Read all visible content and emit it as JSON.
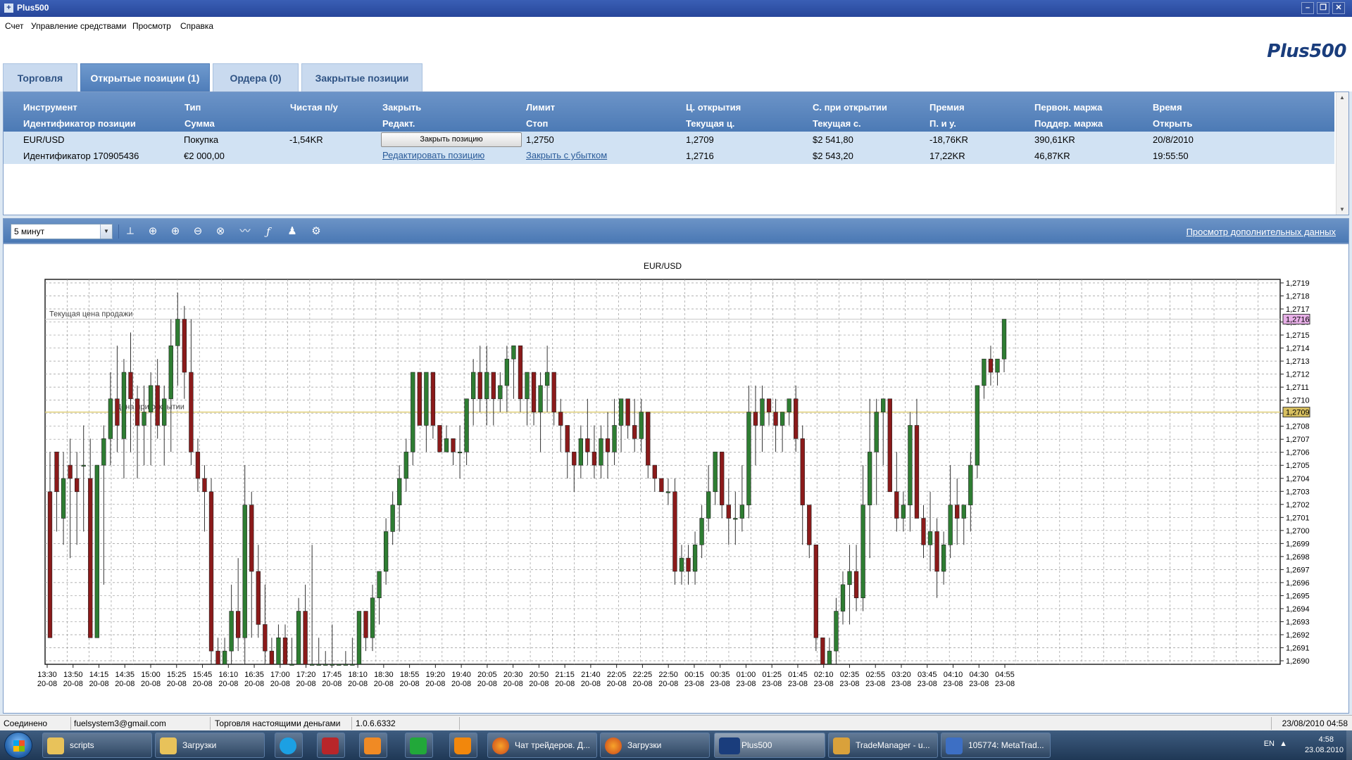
{
  "window": {
    "title": "Plus500",
    "minimize": "–",
    "restore": "❐",
    "close": "✕"
  },
  "menu": [
    "Счет",
    "Управление средствами",
    "Просмотр",
    "Справка"
  ],
  "logo": "Plus500",
  "tabs": [
    "Торговля",
    "Открытые позиции (1)",
    "Ордера (0)",
    "Закрытые позиции"
  ],
  "grid": {
    "header1": [
      "Инструмент",
      "Тип",
      "Чистая п/у",
      "Закрыть",
      "Лимит",
      "Ц. открытия",
      "С. при открытии",
      "Премия",
      "Первон. маржа",
      "Время"
    ],
    "header2": [
      "Идентификатор позиции",
      "Сумма",
      "",
      "Редакт.",
      "Стоп",
      "Текущая ц.",
      "Текущая с.",
      "П. и у.",
      "Поддер. маржа",
      "Открыть"
    ],
    "row1": [
      "EUR/USD",
      "Покупка",
      "-1,54KR",
      "Закрыть позицию",
      "1,2750",
      "1,2709",
      "$2 541,80",
      "-18,76KR",
      "390,61KR",
      "20/8/2010"
    ],
    "row2": [
      "Идентификатор 170905436",
      "€2 000,00",
      "",
      "Редактировать позицию",
      "Закрыть с убытком",
      "1,2716",
      "$2 543,20",
      "17,22KR",
      "46,87KR",
      "19:55:50"
    ]
  },
  "toolbar": {
    "timeframe": "5 минут",
    "more_link": "Просмотр дополнительных данных"
  },
  "chart_data": {
    "type": "candlestick",
    "title": "EUR/USD",
    "ylim": [
      1.269,
      1.2719
    ],
    "y_ticks": [
      "1,2719",
      "1,2718",
      "1,2717",
      "1,2716",
      "1,2715",
      "1,2714",
      "1,2713",
      "1,2712",
      "1,2711",
      "1,2710",
      "1,2709",
      "1,2708",
      "1,2707",
      "1,2706",
      "1,2705",
      "1,2704",
      "1,2703",
      "1,2702",
      "1,2701",
      "1,2700",
      "1,2699",
      "1,2698",
      "1,2697",
      "1,2696",
      "1,2695",
      "1,2694",
      "1,2693",
      "1,2692",
      "1,2691",
      "1,2690"
    ],
    "x_ticks": [
      [
        "13:30",
        "20-08"
      ],
      [
        "13:50",
        "20-08"
      ],
      [
        "14:15",
        "20-08"
      ],
      [
        "14:35",
        "20-08"
      ],
      [
        "15:00",
        "20-08"
      ],
      [
        "15:25",
        "20-08"
      ],
      [
        "15:45",
        "20-08"
      ],
      [
        "16:10",
        "20-08"
      ],
      [
        "16:35",
        "20-08"
      ],
      [
        "17:00",
        "20-08"
      ],
      [
        "17:20",
        "20-08"
      ],
      [
        "17:45",
        "20-08"
      ],
      [
        "18:10",
        "20-08"
      ],
      [
        "18:30",
        "20-08"
      ],
      [
        "18:55",
        "20-08"
      ],
      [
        "19:20",
        "20-08"
      ],
      [
        "19:40",
        "20-08"
      ],
      [
        "20:05",
        "20-08"
      ],
      [
        "20:30",
        "20-08"
      ],
      [
        "20:50",
        "20-08"
      ],
      [
        "21:15",
        "20-08"
      ],
      [
        "21:40",
        "20-08"
      ],
      [
        "22:05",
        "20-08"
      ],
      [
        "22:25",
        "20-08"
      ],
      [
        "22:50",
        "20-08"
      ],
      [
        "00:15",
        "23-08"
      ],
      [
        "00:35",
        "23-08"
      ],
      [
        "01:00",
        "23-08"
      ],
      [
        "01:25",
        "23-08"
      ],
      [
        "01:45",
        "23-08"
      ],
      [
        "02:10",
        "23-08"
      ],
      [
        "02:35",
        "23-08"
      ],
      [
        "02:55",
        "23-08"
      ],
      [
        "03:20",
        "23-08"
      ],
      [
        "03:45",
        "23-08"
      ],
      [
        "04:10",
        "23-08"
      ],
      [
        "04:30",
        "23-08"
      ],
      [
        "04:55",
        "23-08"
      ]
    ],
    "grid": true,
    "sell_price_line": {
      "label": "Текущая цена продажи",
      "value": 1.2716,
      "tag": "1,2716",
      "color": "#e8b0e8"
    },
    "open_price_line": {
      "label": "Цена при открытии",
      "value": 1.2709,
      "tag": "1,2709",
      "color": "#d8c060"
    },
    "candles": [
      [
        1.2703,
        1.2706,
        1.2692,
        1.2692
      ],
      [
        1.2706,
        1.2706,
        1.27,
        1.2703
      ],
      [
        1.2701,
        1.2706,
        1.2699,
        1.2704
      ],
      [
        1.2705,
        1.2707,
        1.2698,
        1.2704
      ],
      [
        1.2704,
        1.2706,
        1.2699,
        1.2703
      ],
      [
        1.2705,
        1.2708,
        1.27,
        1.2705
      ],
      [
        1.2704,
        1.2707,
        1.2692,
        1.2692
      ],
      [
        1.2692,
        1.2705,
        1.2692,
        1.2705
      ],
      [
        1.2705,
        1.2708,
        1.2696,
        1.2707
      ],
      [
        1.2707,
        1.2712,
        1.2705,
        1.271
      ],
      [
        1.271,
        1.2714,
        1.2706,
        1.2708
      ],
      [
        1.2707,
        1.2713,
        1.2704,
        1.2712
      ],
      [
        1.2712,
        1.2715,
        1.2706,
        1.271
      ],
      [
        1.271,
        1.2711,
        1.2704,
        1.2708
      ],
      [
        1.2708,
        1.2711,
        1.2705,
        1.2709
      ],
      [
        1.2709,
        1.2712,
        1.2705,
        1.2711
      ],
      [
        1.2711,
        1.2713,
        1.2707,
        1.2708
      ],
      [
        1.2708,
        1.2711,
        1.2705,
        1.271
      ],
      [
        1.271,
        1.2716,
        1.2706,
        1.2714
      ],
      [
        1.2714,
        1.2718,
        1.2711,
        1.2716
      ],
      [
        1.2716,
        1.2717,
        1.271,
        1.2712
      ],
      [
        1.2712,
        1.2716,
        1.2705,
        1.2706
      ],
      [
        1.2706,
        1.2707,
        1.2703,
        1.2704
      ],
      [
        1.2704,
        1.2705,
        1.27,
        1.2703
      ],
      [
        1.2703,
        1.2704,
        1.269,
        1.2691
      ],
      [
        1.2691,
        1.2692,
        1.269,
        1.269
      ],
      [
        1.269,
        1.2692,
        1.269,
        1.2691
      ],
      [
        1.2691,
        1.2696,
        1.269,
        1.2694
      ],
      [
        1.2694,
        1.2698,
        1.2691,
        1.2692
      ],
      [
        1.2692,
        1.2705,
        1.269,
        1.2702
      ],
      [
        1.2702,
        1.2703,
        1.2692,
        1.2697
      ],
      [
        1.2697,
        1.2699,
        1.2692,
        1.2693
      ],
      [
        1.2693,
        1.2696,
        1.269,
        1.2691
      ],
      [
        1.2691,
        1.2692,
        1.269,
        1.269
      ],
      [
        1.269,
        1.2693,
        1.269,
        1.2692
      ],
      [
        1.2692,
        1.2693,
        1.269,
        1.269
      ],
      [
        1.269,
        1.2692,
        1.269,
        1.269
      ],
      [
        1.269,
        1.2695,
        1.269,
        1.2694
      ],
      [
        1.2694,
        1.2696,
        1.269,
        1.269
      ],
      [
        1.269,
        1.2699,
        1.269,
        1.269
      ],
      [
        1.269,
        1.2692,
        1.269,
        1.269
      ],
      [
        1.269,
        1.2691,
        1.269,
        1.269
      ],
      [
        1.269,
        1.2693,
        1.269,
        1.269
      ],
      [
        1.269,
        1.269,
        1.269,
        1.269
      ],
      [
        1.269,
        1.2691,
        1.269,
        1.269
      ],
      [
        1.269,
        1.2692,
        1.269,
        1.269
      ],
      [
        1.269,
        1.2694,
        1.269,
        1.2694
      ],
      [
        1.2694,
        1.2694,
        1.2691,
        1.2692
      ],
      [
        1.2692,
        1.2696,
        1.2691,
        1.2695
      ],
      [
        1.2695,
        1.2697,
        1.2693,
        1.2697
      ],
      [
        1.2697,
        1.2701,
        1.2696,
        1.27
      ],
      [
        1.27,
        1.2703,
        1.2699,
        1.2702
      ],
      [
        1.2702,
        1.2705,
        1.27,
        1.2704
      ],
      [
        1.2704,
        1.2707,
        1.2703,
        1.2706
      ],
      [
        1.2706,
        1.2712,
        1.2705,
        1.2712
      ],
      [
        1.2712,
        1.2712,
        1.2708,
        1.2708
      ],
      [
        1.2708,
        1.2712,
        1.2706,
        1.2712
      ],
      [
        1.2712,
        1.2712,
        1.2707,
        1.2708
      ],
      [
        1.2708,
        1.2708,
        1.2706,
        1.2706
      ],
      [
        1.2706,
        1.2708,
        1.2706,
        1.2707
      ],
      [
        1.2707,
        1.2707,
        1.2705,
        1.2706
      ],
      [
        1.2706,
        1.2708,
        1.2704,
        1.2706
      ],
      [
        1.2706,
        1.271,
        1.2705,
        1.271
      ],
      [
        1.271,
        1.2713,
        1.2708,
        1.2712
      ],
      [
        1.2712,
        1.2714,
        1.2709,
        1.271
      ],
      [
        1.271,
        1.2714,
        1.2708,
        1.2712
      ],
      [
        1.2712,
        1.2712,
        1.2708,
        1.271
      ],
      [
        1.271,
        1.2712,
        1.2709,
        1.2711
      ],
      [
        1.2711,
        1.2714,
        1.2709,
        1.2713
      ],
      [
        1.2713,
        1.2714,
        1.271,
        1.2714
      ],
      [
        1.2714,
        1.2714,
        1.2709,
        1.271
      ],
      [
        1.271,
        1.2712,
        1.2708,
        1.2712
      ],
      [
        1.2712,
        1.2712,
        1.2708,
        1.2709
      ],
      [
        1.2709,
        1.2712,
        1.2706,
        1.2711
      ],
      [
        1.2711,
        1.2714,
        1.2709,
        1.2712
      ],
      [
        1.2712,
        1.2712,
        1.2708,
        1.2709
      ],
      [
        1.2709,
        1.271,
        1.2706,
        1.2708
      ],
      [
        1.2708,
        1.2708,
        1.2704,
        1.2706
      ],
      [
        1.2706,
        1.2706,
        1.2703,
        1.2705
      ],
      [
        1.2705,
        1.2708,
        1.2704,
        1.2707
      ],
      [
        1.2707,
        1.271,
        1.2705,
        1.2706
      ],
      [
        1.2706,
        1.2708,
        1.2704,
        1.2705
      ],
      [
        1.2705,
        1.2708,
        1.2704,
        1.2707
      ],
      [
        1.2707,
        1.2709,
        1.2704,
        1.2706
      ],
      [
        1.2706,
        1.271,
        1.2705,
        1.2708
      ],
      [
        1.2708,
        1.271,
        1.2706,
        1.271
      ],
      [
        1.271,
        1.271,
        1.2707,
        1.2708
      ],
      [
        1.2708,
        1.271,
        1.2706,
        1.2707
      ],
      [
        1.2707,
        1.271,
        1.2706,
        1.2709
      ],
      [
        1.2709,
        1.2709,
        1.2704,
        1.2705
      ],
      [
        1.2705,
        1.2705,
        1.2703,
        1.2704
      ],
      [
        1.2704,
        1.2704,
        1.2703,
        1.2703
      ],
      [
        1.2703,
        1.2704,
        1.2702,
        1.2703
      ],
      [
        1.2703,
        1.2704,
        1.2696,
        1.2697
      ],
      [
        1.2697,
        1.2699,
        1.2696,
        1.2698
      ],
      [
        1.2698,
        1.2699,
        1.2696,
        1.2697
      ],
      [
        1.2697,
        1.27,
        1.2696,
        1.2699
      ],
      [
        1.2699,
        1.2702,
        1.2698,
        1.2701
      ],
      [
        1.2701,
        1.2705,
        1.27,
        1.2703
      ],
      [
        1.2703,
        1.2706,
        1.2702,
        1.2706
      ],
      [
        1.2706,
        1.2706,
        1.2701,
        1.2702
      ],
      [
        1.2702,
        1.2704,
        1.2699,
        1.2701
      ],
      [
        1.2701,
        1.2703,
        1.2699,
        1.2701
      ],
      [
        1.2701,
        1.2705,
        1.27,
        1.2702
      ],
      [
        1.2702,
        1.2711,
        1.2701,
        1.2709
      ],
      [
        1.2709,
        1.2711,
        1.2705,
        1.2708
      ],
      [
        1.2708,
        1.2711,
        1.2706,
        1.271
      ],
      [
        1.271,
        1.271,
        1.2708,
        1.2709
      ],
      [
        1.2709,
        1.271,
        1.2706,
        1.2708
      ],
      [
        1.2708,
        1.2709,
        1.2706,
        1.2709
      ],
      [
        1.2709,
        1.271,
        1.2708,
        1.271
      ],
      [
        1.271,
        1.2711,
        1.2706,
        1.2707
      ],
      [
        1.2707,
        1.2708,
        1.2699,
        1.2702
      ],
      [
        1.2702,
        1.2702,
        1.2698,
        1.2699
      ],
      [
        1.2699,
        1.2699,
        1.2691,
        1.2692
      ],
      [
        1.2692,
        1.2692,
        1.269,
        1.269
      ],
      [
        1.269,
        1.2692,
        1.269,
        1.2691
      ],
      [
        1.2691,
        1.2695,
        1.269,
        1.2694
      ],
      [
        1.2694,
        1.2697,
        1.2693,
        1.2696
      ],
      [
        1.2696,
        1.2699,
        1.2693,
        1.2697
      ],
      [
        1.2697,
        1.2699,
        1.2694,
        1.2695
      ],
      [
        1.2695,
        1.2705,
        1.2694,
        1.2702
      ],
      [
        1.2702,
        1.271,
        1.2698,
        1.2706
      ],
      [
        1.2706,
        1.271,
        1.2702,
        1.2709
      ],
      [
        1.2709,
        1.271,
        1.2705,
        1.271
      ],
      [
        1.271,
        1.271,
        1.2703,
        1.2703
      ],
      [
        1.2703,
        1.2706,
        1.27,
        1.2701
      ],
      [
        1.2701,
        1.2703,
        1.27,
        1.2702
      ],
      [
        1.2702,
        1.2709,
        1.27,
        1.2708
      ],
      [
        1.2708,
        1.271,
        1.2702,
        1.2701
      ],
      [
        1.2701,
        1.2702,
        1.2698,
        1.2699
      ],
      [
        1.2699,
        1.2703,
        1.2697,
        1.27
      ],
      [
        1.27,
        1.2701,
        1.2695,
        1.2697
      ],
      [
        1.2697,
        1.27,
        1.2696,
        1.2699
      ],
      [
        1.2699,
        1.2705,
        1.2698,
        1.2702
      ],
      [
        1.2702,
        1.2704,
        1.2699,
        1.2701
      ],
      [
        1.2701,
        1.2702,
        1.2699,
        1.2702
      ],
      [
        1.2702,
        1.2706,
        1.27,
        1.2705
      ],
      [
        1.2705,
        1.2711,
        1.2704,
        1.2711
      ],
      [
        1.2711,
        1.2713,
        1.271,
        1.2713
      ],
      [
        1.2713,
        1.2714,
        1.2711,
        1.2712
      ],
      [
        1.2712,
        1.2713,
        1.2711,
        1.2713
      ],
      [
        1.2713,
        1.2716,
        1.2712,
        1.2716
      ]
    ]
  },
  "status": {
    "state": "Соединено",
    "email": "fuelsystem3@gmail.com",
    "mode": "Торговля настоящими деньгами",
    "version": "1.0.6.6332",
    "datetime": "23/08/2010 04:58"
  },
  "taskbar": {
    "items": [
      {
        "label": "scripts",
        "icon": "folder-icon"
      },
      {
        "label": "Загрузки",
        "icon": "folder-icon"
      },
      {
        "label": "",
        "icon": "skype-icon"
      },
      {
        "label": "",
        "icon": "transformers-icon"
      },
      {
        "label": "",
        "icon": "media-player-icon"
      },
      {
        "label": "",
        "icon": "green-app-icon"
      },
      {
        "label": "",
        "icon": "vlc-icon"
      },
      {
        "label": "Чат трейдеров. Д...",
        "icon": "firefox-icon"
      },
      {
        "label": "Загрузки",
        "icon": "firefox-icon"
      },
      {
        "label": "Plus500",
        "icon": "plus500-icon"
      },
      {
        "label": "TradeManager - u...",
        "icon": "trademanager-icon"
      },
      {
        "label": "105774: MetaTrad...",
        "icon": "metatrader-icon"
      }
    ],
    "lang": "EN",
    "time": "4:58",
    "date": "23.08.2010"
  }
}
